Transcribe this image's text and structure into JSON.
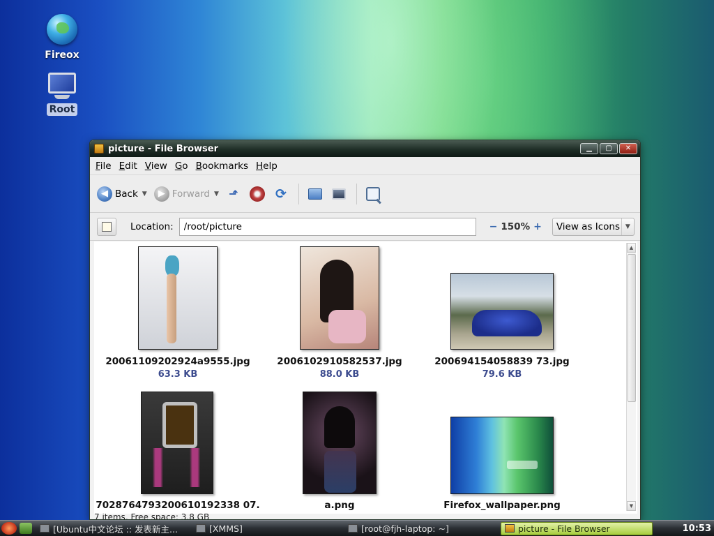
{
  "desktop": {
    "icons": [
      {
        "label": "Fireox",
        "icon": "globe-icon"
      },
      {
        "label": "Root",
        "icon": "computer-icon"
      }
    ]
  },
  "window": {
    "title": "picture - File Browser",
    "buttons": {
      "minimize": "▁",
      "maximize": "▢",
      "close": "✕"
    }
  },
  "menu": [
    {
      "u": "F",
      "rest": "ile"
    },
    {
      "u": "E",
      "rest": "dit"
    },
    {
      "u": "V",
      "rest": "iew"
    },
    {
      "u": "G",
      "rest": "o"
    },
    {
      "u": "B",
      "rest": "ookmarks"
    },
    {
      "u": "H",
      "rest": "elp"
    }
  ],
  "toolbar": {
    "back": "Back",
    "forward": "Forward",
    "icons": [
      "up-icon",
      "stop-icon",
      "reload-icon",
      "home-icon",
      "computer-icon",
      "search-icon"
    ]
  },
  "location": {
    "label": "Location:",
    "value": "/root/picture",
    "zoom": "150%",
    "view_mode": "View as Icons"
  },
  "files": [
    {
      "name": "20061109202924a9555.jpg",
      "size": "63.3 KB"
    },
    {
      "name": "2006102910582537.jpg",
      "size": "88.0 KB"
    },
    {
      "name": "200694154058839 73.jpg",
      "size": "79.6 KB"
    },
    {
      "name": "7028764793200610192338 07.",
      "size": ""
    },
    {
      "name": "a.png",
      "size": ""
    },
    {
      "name": "Firefox_wallpaper.png",
      "size": ""
    }
  ],
  "status": "7 items, Free space: 3.8 GB",
  "taskbar": {
    "tasks": [
      "[Ubuntu中文论坛 :: 发表新主...",
      "[XMMS]",
      "[root@fjh-laptop: ~]",
      "picture - File Browser"
    ],
    "clock": "10:53"
  }
}
